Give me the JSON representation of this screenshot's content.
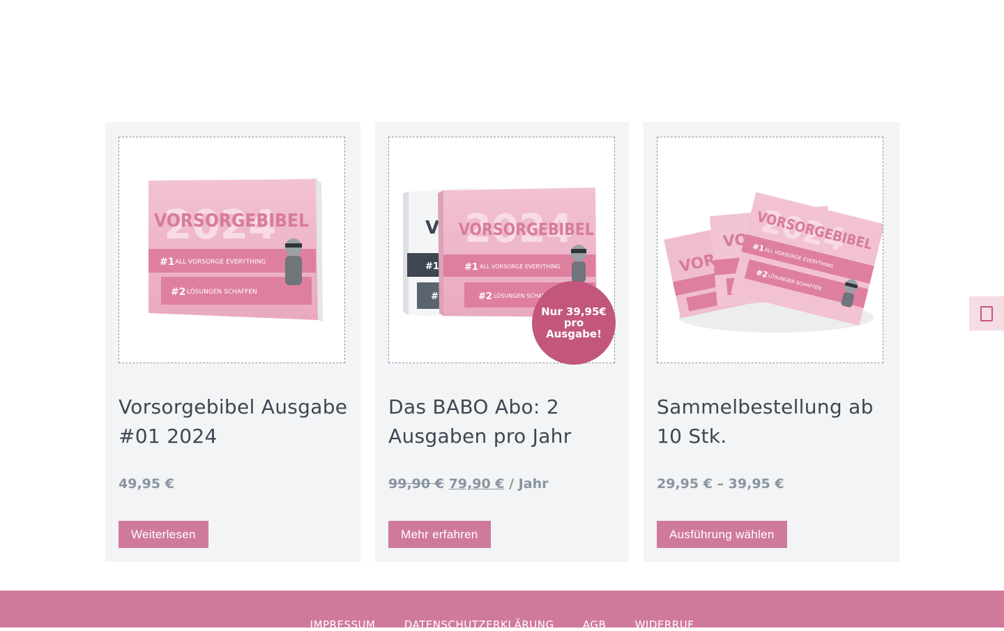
{
  "products": [
    {
      "image_alt": "Vorsorgebibel 2024 Buch",
      "title": "Vorsorgebibel Ausgabe #01 2024",
      "price": "49,95 €",
      "button": "Weiterlesen"
    },
    {
      "image_alt": "Vorsorgebibel Abo zwei Bücher",
      "title": "Das BABO Abo: 2 Ausgaben pro Jahr",
      "price_old": "99,90 €",
      "price_new": "79,90 €",
      "price_suffix": "/ Jahr",
      "badge": "Nur 39,95€ pro Ausgabe!",
      "button": "Mehr erfahren"
    },
    {
      "image_alt": "Vorsorgebibel Sammelbestellung Stapel",
      "title": "Sammelbestellung ab 10 Stk.",
      "price": "29,95 € – 39,95 €",
      "button": "Ausführung wählen"
    }
  ],
  "book_cover": {
    "year": "2024",
    "title": "VORSORGEBIBEL",
    "line1_num": "#1",
    "line1": "ALL VORSORGE EVERYTHING",
    "line2_num": "#2",
    "line2": "LÖSUNGEN SCHAFFEN"
  },
  "footer": {
    "links": [
      "IMPRESSUM",
      "DATENSCHUTZERKLÄRUNG",
      "AGB",
      "WIDERRUF"
    ]
  },
  "colors": {
    "accent": "#d07a9b",
    "badge": "#c2567d",
    "card_bg": "#f2f4f6",
    "price": "#8a94a0"
  },
  "icons": {
    "side_tab": "accessibility-icon"
  }
}
